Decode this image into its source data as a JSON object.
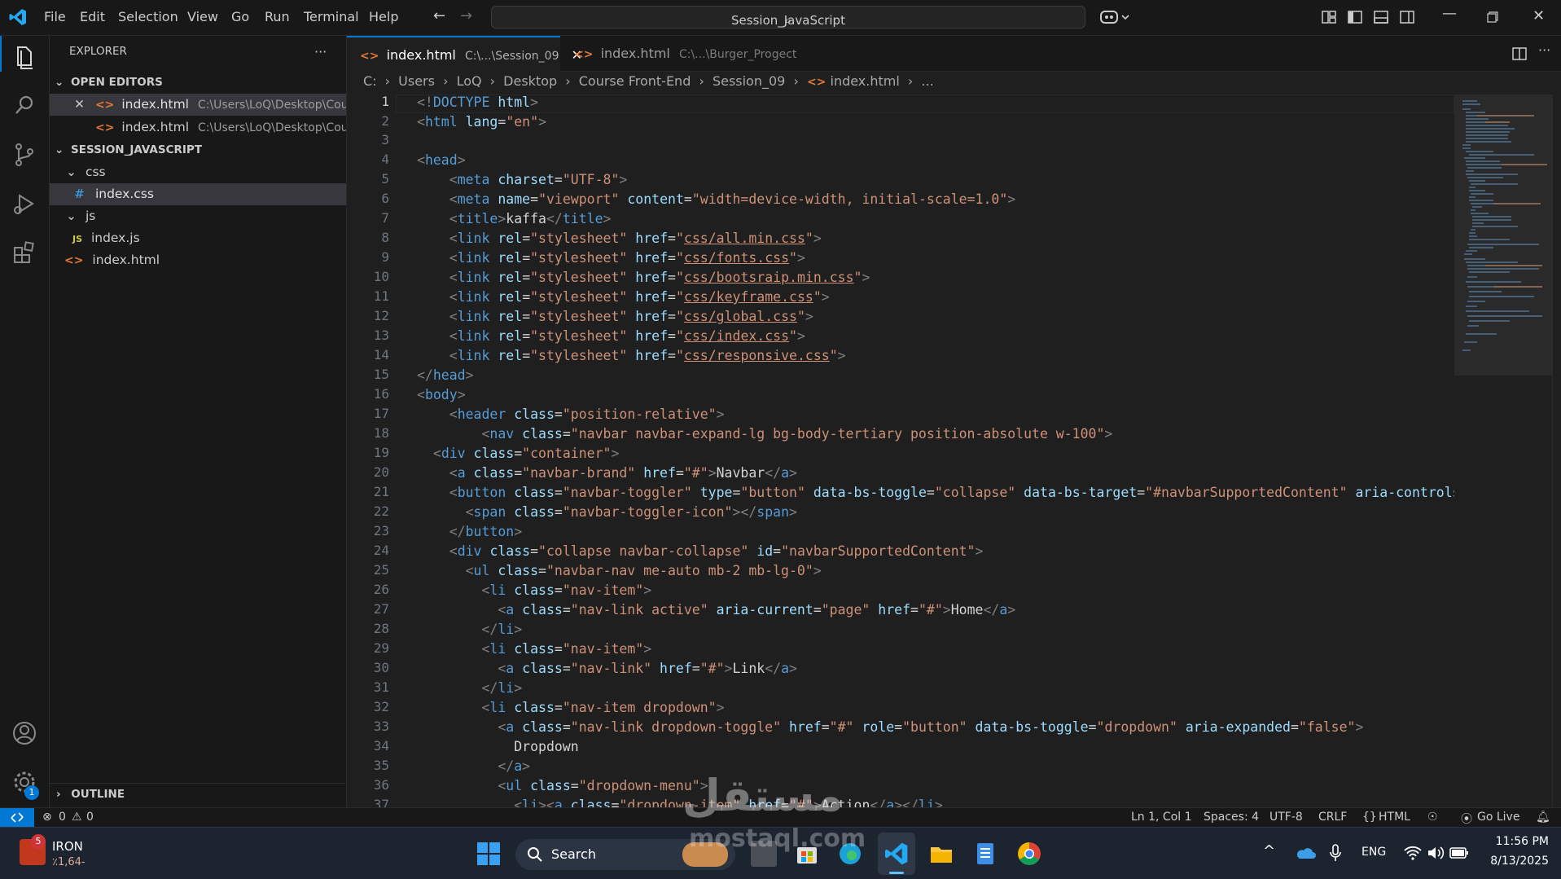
{
  "titlebar": {
    "menus": [
      "File",
      "Edit",
      "Selection",
      "View",
      "Go",
      "Run",
      "Terminal",
      "Help"
    ],
    "search_text": "Session_JavaScript"
  },
  "sidebar": {
    "title": "EXPLORER",
    "open_editors_label": "OPEN EDITORS",
    "open_editors": [
      {
        "name": "index.html",
        "path": "C:\\Users\\LoQ\\Desktop\\Cours..."
      },
      {
        "name": "index.html",
        "path": "C:\\Users\\LoQ\\Desktop\\Cours..."
      }
    ],
    "folder_label": "SESSION_JAVASCRIPT",
    "tree": [
      {
        "name": "css",
        "type": "folder"
      },
      {
        "name": "index.css",
        "type": "css"
      },
      {
        "name": "js",
        "type": "folder"
      },
      {
        "name": "index.js",
        "type": "js"
      },
      {
        "name": "index.html",
        "type": "html"
      }
    ],
    "outline_label": "OUTLINE",
    "css_icon": "#",
    "js_icon": "JS"
  },
  "tabs": [
    {
      "name": "index.html",
      "path": "C:\\...\\Session_09",
      "active": true
    },
    {
      "name": "index.html",
      "path": "C:\\...\\Burger_Progect",
      "active": false
    }
  ],
  "breadcrumb": [
    "C:",
    "Users",
    "LoQ",
    "Desktop",
    "Course Front-End",
    "Session_09",
    "index.html",
    "..."
  ],
  "editor": {
    "line_numbers": [
      "1",
      "2",
      "3",
      "4",
      "5",
      "6",
      "7",
      "8",
      "9",
      "10",
      "11",
      "12",
      "13",
      "14",
      "15",
      "16",
      "17",
      "18",
      "19",
      "20",
      "21",
      "22",
      "23",
      "24",
      "25",
      "26",
      "27",
      "28",
      "29",
      "30",
      "31",
      "32",
      "33",
      "34",
      "35",
      "36",
      "37"
    ]
  },
  "statusbar": {
    "errors": "0",
    "warnings": "0",
    "position": "Ln 1, Col 1",
    "spaces": "Spaces: 4",
    "encoding": "UTF-8",
    "eol": "CRLF",
    "language": "HTML",
    "golive": "Go Live",
    "badge": "1"
  },
  "taskbar": {
    "weather_title": "IRON",
    "weather_sub": "٪1,64-",
    "weather_badge": "5",
    "search_label": "Search",
    "lang": "ENG",
    "time": "11:56 PM",
    "date": "8/13/2025",
    "watermark": "مستقل",
    "watermark_sub": "mostaql.com"
  },
  "colors": {
    "accent": "#0078d4",
    "tag": "#569cd6",
    "attr": "#9cdcfe",
    "string": "#ce9178",
    "html_icon": "#e37933",
    "css_icon": "#42a5f5",
    "js_icon": "#cbcb41"
  }
}
